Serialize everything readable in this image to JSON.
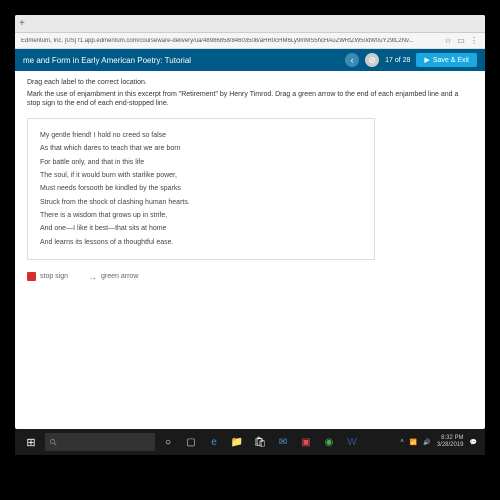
{
  "browser": {
    "url": "Edmentum, Inc. [US]   f1.app.edmentum.com/courseware-delivery/ua/48986858/84603508/aHR0cHM6Ly9mMS5hcHAuZWRtZW50dW0uY29tL2Nv..."
  },
  "header": {
    "title": "me and Form in Early American Poetry: Tutorial",
    "page_current": 17,
    "page_total": 28,
    "save_label": "Save & Exit"
  },
  "instructions": {
    "line1": "Drag each label to the correct location.",
    "line2": "Mark the use of enjambment in this excerpt from \"Retirement\" by Henry Timrod. Drag a green arrow to the end of each enjambed line and a stop sign to the end of each end-stopped line."
  },
  "poem_lines": [
    "My gentle friend! I hold no creed so false",
    "As that which dares to teach that we are born",
    "For battle only, and that in this life",
    "The soul, if it would burn with starlike power,",
    "Must needs forsooth be kindled by the sparks",
    "Struck from the shock of clashing human hearts.",
    "There is a wisdom that grows up in strife,",
    "And one—I like it best—that sits at home",
    "And learns its lessons of a thoughtful ease."
  ],
  "labels": {
    "stop": "stop sign",
    "arrow": "green arrow"
  },
  "taskbar": {
    "time": "8:32 PM",
    "date": "3/28/2019"
  }
}
